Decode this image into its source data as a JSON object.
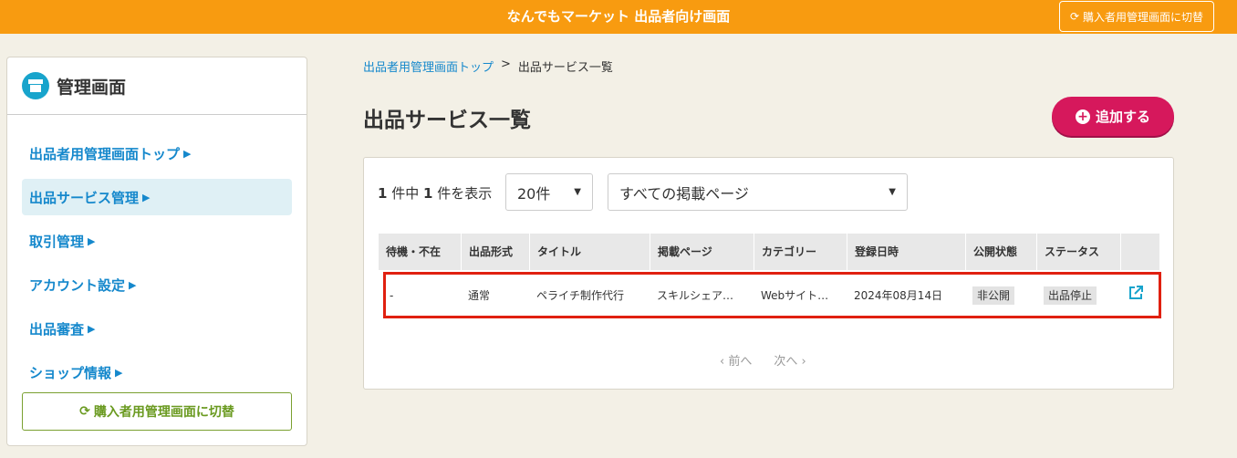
{
  "header": {
    "title": "なんでもマーケット 出品者向け画面",
    "switch_label": "購入者用管理画面に切替"
  },
  "sidebar": {
    "title": "管理画面",
    "items": [
      {
        "label": "出品者用管理画面トップ"
      },
      {
        "label": "出品サービス管理"
      },
      {
        "label": "取引管理"
      },
      {
        "label": "アカウント設定"
      },
      {
        "label": "出品審査"
      },
      {
        "label": "ショップ情報"
      }
    ],
    "switch_label": "購入者用管理画面に切替"
  },
  "breadcrumb": {
    "home": "出品者用管理画面トップ",
    "separator": ">",
    "current": "出品サービス一覧"
  },
  "page_title": "出品サービス一覧",
  "add_button": "追加する",
  "filters": {
    "count_total": "1",
    "count_mid": "件中",
    "count_shown": "1",
    "count_suffix": "件を表示",
    "per_page": "20件",
    "page_filter": "すべての掲載ページ"
  },
  "table": {
    "headers": [
      "待機・不在",
      "出品形式",
      "タイトル",
      "掲載ページ",
      "カテゴリー",
      "登録日時",
      "公開状態",
      "ステータス"
    ],
    "row": {
      "wait": "-",
      "format": "通常",
      "title": "ペライチ制作代行",
      "page": "スキルシェア…",
      "category": "Webサイト…",
      "date": "2024年08月14日",
      "visibility": "非公開",
      "status": "出品停止"
    }
  },
  "pager": {
    "prev": "前へ",
    "next": "次へ"
  },
  "colors": {
    "header_bg": "#f89b10",
    "accent": "#1588cc",
    "add_button": "#d6185c",
    "highlight": "#e02010"
  }
}
